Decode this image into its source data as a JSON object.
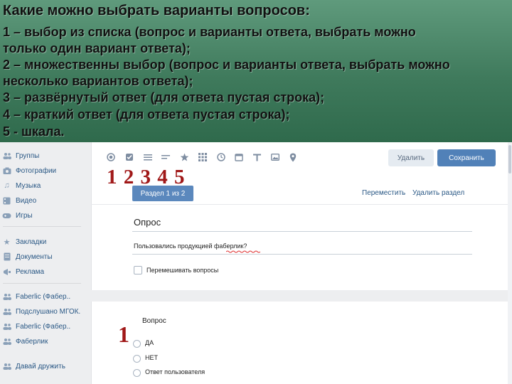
{
  "banner": {
    "title": "Какие можно выбрать варианты вопросов:",
    "lines": [
      "1 – выбор из списка (вопрос и варианты ответа, выбрать можно",
      "только один вариант ответа);",
      "2 – множественны выбор (вопрос и варианты ответа, выбрать можно",
      "несколько вариантов ответа);",
      "3 – развёрнутый ответ (для ответа пустая строка);",
      "4 – краткий ответ (для ответа пустая строка);",
      "5 -  шкала."
    ]
  },
  "sidebar": {
    "items": [
      {
        "label": "Группы",
        "icon": "groups-icon"
      },
      {
        "label": "Фотографии",
        "icon": "camera-icon"
      },
      {
        "label": "Музыка",
        "icon": "music-icon"
      },
      {
        "label": "Видео",
        "icon": "video-icon"
      },
      {
        "label": "Игры",
        "icon": "gamepad-icon"
      },
      {
        "label": "Закладки",
        "icon": "star-icon"
      },
      {
        "label": "Документы",
        "icon": "document-icon"
      },
      {
        "label": "Реклама",
        "icon": "megaphone-icon"
      },
      {
        "label": "Faberlic (Фабер..",
        "icon": "groups-icon"
      },
      {
        "label": "Подслушано МГОК.",
        "icon": "groups-icon"
      },
      {
        "label": "Faberlic (Фабер..",
        "icon": "groups-icon"
      },
      {
        "label": "Фаберлик",
        "icon": "groups-icon"
      },
      {
        "label": "Давай дружить",
        "icon": "groups-icon"
      }
    ]
  },
  "toolbar": {
    "icons": [
      "radio-icon",
      "checkbox-icon",
      "paragraph-icon",
      "short-text-icon",
      "scale-icon",
      "grid-icon",
      "clock-icon",
      "calendar-icon",
      "text-icon",
      "image-icon",
      "location-icon"
    ],
    "delete_label": "Удалить",
    "save_label": "Сохранить"
  },
  "annotations": {
    "types": "1 2 3 4 5",
    "single": "1"
  },
  "section": {
    "tab_label": "Раздел 1 из 2",
    "move_label": "Переместить",
    "delete_section_label": "Удалить раздел"
  },
  "form": {
    "title": "Опрос",
    "description": "Пользовались продукцией фаберлик?",
    "shuffle_label": "Перемешивать вопросы"
  },
  "question": {
    "title": "Вопрос",
    "options": [
      "ДА",
      "НЕТ",
      "Ответ пользователя"
    ]
  },
  "colors": {
    "accent": "#5181b8",
    "banner": "#4a8566",
    "annotation": "#a01818"
  }
}
